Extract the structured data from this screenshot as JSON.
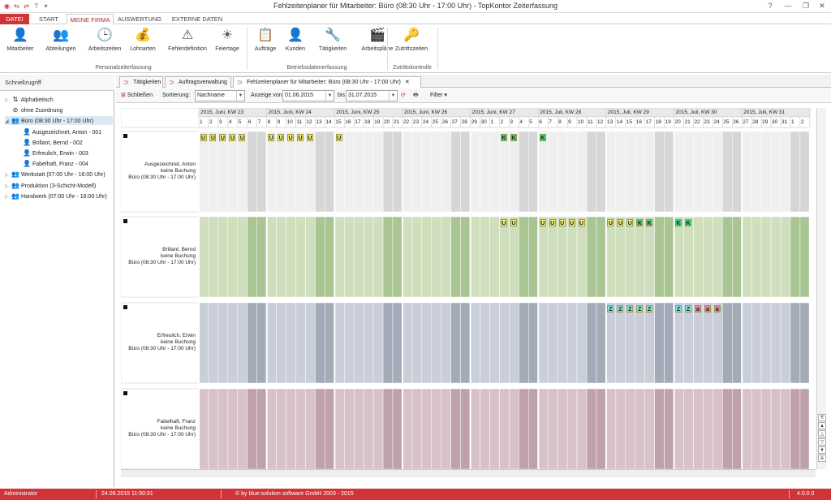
{
  "window": {
    "title": "Fehlzeitenplaner für Mitarbeiter: Büro (08:30 Uhr - 17:00 Uhr) - TopKontor Zeiterfassung"
  },
  "ribbon_tabs": [
    {
      "label": "DATEI",
      "kind": "file"
    },
    {
      "label": "START",
      "kind": "normal"
    },
    {
      "label": "MEINE FIRMA",
      "kind": "active"
    },
    {
      "label": "AUSWERTUNG",
      "kind": "normal"
    },
    {
      "label": "EXTERNE DATEN",
      "kind": "normal"
    }
  ],
  "ribbon_groups": [
    {
      "label": "Personalzeiterfassung",
      "buttons": [
        {
          "label": "Mitarbeiter",
          "icon": "person-icon",
          "glyph": "👤"
        },
        {
          "label": "Abteilungen",
          "icon": "group-icon",
          "glyph": "👥"
        },
        {
          "label": "Arbeitszeiten",
          "icon": "clock-icon",
          "glyph": "🕒"
        },
        {
          "label": "Lohnarten",
          "icon": "coins-icon",
          "glyph": "💰"
        },
        {
          "label": "Fehlerdefinition",
          "icon": "warning-icon",
          "glyph": "⚠"
        },
        {
          "label": "Feiertage",
          "icon": "sun-icon",
          "glyph": "☀"
        }
      ]
    },
    {
      "label": "Betriebsdatenerfassung",
      "buttons": [
        {
          "label": "Aufträge",
          "icon": "orders-icon",
          "glyph": "📋"
        },
        {
          "label": "Kunden",
          "icon": "customer-icon",
          "glyph": "👤"
        },
        {
          "label": "Tätigkeiten",
          "icon": "tools-icon",
          "glyph": "🔧"
        },
        {
          "label": "Arbeitspläne",
          "icon": "plan-icon",
          "glyph": "🎬"
        }
      ]
    },
    {
      "label": "Zutrittskontrolle",
      "buttons": [
        {
          "label": "Zutrittszeiten",
          "icon": "key-icon",
          "glyph": "🔑"
        }
      ]
    }
  ],
  "sidebar": {
    "title": "Schnellzugriff",
    "items": [
      {
        "label": "Alphabetisch",
        "icon": "sort-az-icon",
        "glyph": "⇅",
        "level": 0,
        "expander": "▷",
        "selected": false
      },
      {
        "label": "ohne Zuordnung",
        "icon": "no-entry-icon",
        "glyph": "⊘",
        "level": 0,
        "expander": "",
        "selected": false
      },
      {
        "label": "Büro (08:30 Uhr - 17:00 Uhr)",
        "icon": "group-icon",
        "glyph": "👥",
        "level": 0,
        "expander": "◢",
        "selected": true
      },
      {
        "label": "Ausgezeichnet, Anton - 001",
        "icon": "person-icon",
        "glyph": "👤",
        "level": 1,
        "expander": "",
        "selected": false
      },
      {
        "label": "Brillant, Bernd - 002",
        "icon": "person-icon",
        "glyph": "👤",
        "level": 1,
        "expander": "",
        "selected": false
      },
      {
        "label": "Erfreulich, Erwin - 003",
        "icon": "person-icon",
        "glyph": "👤",
        "level": 1,
        "expander": "",
        "selected": false
      },
      {
        "label": "Fabelhaft, Franz - 004",
        "icon": "person-icon",
        "glyph": "👤",
        "level": 1,
        "expander": "",
        "selected": false
      },
      {
        "label": "Werkstatt (07:00 Uhr - 16:00 Uhr)",
        "icon": "group-icon",
        "glyph": "👥",
        "level": 0,
        "expander": "▷",
        "selected": false
      },
      {
        "label": "Produktion (3-Schicht-Modell)",
        "icon": "group-icon",
        "glyph": "👥",
        "level": 0,
        "expander": "▷",
        "selected": false
      },
      {
        "label": "Handwerk (07:00 Uhr - 16:00 Uhr)",
        "icon": "group-icon",
        "glyph": "👥",
        "level": 0,
        "expander": "▷",
        "selected": false
      }
    ]
  },
  "doc_tabs": [
    {
      "label": "Tätigkeiten",
      "active": false
    },
    {
      "label": "Auftragsverwaltung",
      "active": false
    },
    {
      "label": "Fehlzeitenplaner für Mitarbeiter: Büro (08:30 Uhr - 17:00 Uhr)",
      "active": true,
      "closable": "✕"
    }
  ],
  "toolbar": {
    "close_label": "Schließen",
    "sort_label": "Sortierung:",
    "sort_value": "Nachname",
    "from_label": "Anzeige von",
    "from_value": "01.06.2015",
    "to_label": "bis",
    "to_value": "31.07.2015",
    "filter_label": "Filter"
  },
  "calendar": {
    "weeks": [
      {
        "label": "2015, Juni, KW 23",
        "days": [
          "1",
          "2",
          "3",
          "4",
          "5",
          "6",
          "7"
        ]
      },
      {
        "label": "2015, Juni, KW 24",
        "days": [
          "8",
          "9",
          "10",
          "11",
          "12",
          "13",
          "14"
        ]
      },
      {
        "label": "2015, Juni, KW 25",
        "days": [
          "15",
          "16",
          "17",
          "18",
          "19",
          "20",
          "21"
        ]
      },
      {
        "label": "2015, Juni, KW 26",
        "days": [
          "22",
          "23",
          "24",
          "25",
          "26",
          "27",
          "28"
        ]
      },
      {
        "label": "2015, Juni, KW 27",
        "days": [
          "29",
          "30",
          "1",
          "2",
          "3",
          "4",
          "5"
        ]
      },
      {
        "label": "2015, Juli, KW 28",
        "days": [
          "6",
          "7",
          "8",
          "9",
          "10",
          "11",
          "12"
        ]
      },
      {
        "label": "2015, Juli, KW 29",
        "days": [
          "13",
          "14",
          "15",
          "16",
          "17",
          "18",
          "19"
        ]
      },
      {
        "label": "2015, Juli, KW 30",
        "days": [
          "20",
          "21",
          "22",
          "23",
          "24",
          "25",
          "26"
        ]
      },
      {
        "label": "2015, Juli, KW 31",
        "days": [
          "27",
          "28",
          "29",
          "30",
          "31",
          "1",
          "2"
        ]
      }
    ],
    "badge_colors": {
      "U": "#f3ef7a",
      "K": "#35d98a",
      "Z": "#7ee6e6",
      "a": "#f07ab0"
    },
    "employees": [
      {
        "name": "Ausgezeichnet, Anton",
        "status": "keine Buchung",
        "dept": "Büro (08:30 Uhr - 17:00 Uhr)",
        "weekday_color": "#efefef",
        "weekend_color": "#d6d6d6",
        "absences": [
          {
            "week": 0,
            "day": 0,
            "code": "U"
          },
          {
            "week": 0,
            "day": 1,
            "code": "U"
          },
          {
            "week": 0,
            "day": 2,
            "code": "U"
          },
          {
            "week": 0,
            "day": 3,
            "code": "U"
          },
          {
            "week": 0,
            "day": 4,
            "code": "U"
          },
          {
            "week": 1,
            "day": 0,
            "code": "U"
          },
          {
            "week": 1,
            "day": 1,
            "code": "U"
          },
          {
            "week": 1,
            "day": 2,
            "code": "U"
          },
          {
            "week": 1,
            "day": 3,
            "code": "U"
          },
          {
            "week": 1,
            "day": 4,
            "code": "U"
          },
          {
            "week": 2,
            "day": 0,
            "code": "U"
          },
          {
            "week": 4,
            "day": 3,
            "code": "K"
          },
          {
            "week": 4,
            "day": 4,
            "code": "K"
          },
          {
            "week": 5,
            "day": 0,
            "code": "K"
          }
        ]
      },
      {
        "name": "Brillant, Bernd",
        "status": "keine Buchung",
        "dept": "Büro (08:30 Uhr - 17:00 Uhr)",
        "weekday_color": "#cfdfbd",
        "weekend_color": "#a9c592",
        "absences": [
          {
            "week": 4,
            "day": 3,
            "code": "U"
          },
          {
            "week": 4,
            "day": 4,
            "code": "U"
          },
          {
            "week": 5,
            "day": 0,
            "code": "U"
          },
          {
            "week": 5,
            "day": 1,
            "code": "U"
          },
          {
            "week": 5,
            "day": 2,
            "code": "U"
          },
          {
            "week": 5,
            "day": 3,
            "code": "U"
          },
          {
            "week": 5,
            "day": 4,
            "code": "U"
          },
          {
            "week": 6,
            "day": 0,
            "code": "U"
          },
          {
            "week": 6,
            "day": 1,
            "code": "U"
          },
          {
            "week": 6,
            "day": 2,
            "code": "U"
          },
          {
            "week": 6,
            "day": 3,
            "code": "K"
          },
          {
            "week": 6,
            "day": 4,
            "code": "K"
          },
          {
            "week": 7,
            "day": 0,
            "code": "K"
          },
          {
            "week": 7,
            "day": 1,
            "code": "K"
          }
        ]
      },
      {
        "name": "Erfreulich, Erwin",
        "status": "keine Buchung",
        "dept": "Büro (08:30 Uhr - 17:00 Uhr)",
        "weekday_color": "#c9ced8",
        "weekend_color": "#a4abb8",
        "absences": [
          {
            "week": 6,
            "day": 0,
            "code": "Z"
          },
          {
            "week": 6,
            "day": 1,
            "code": "Z"
          },
          {
            "week": 6,
            "day": 2,
            "code": "Z"
          },
          {
            "week": 6,
            "day": 3,
            "code": "Z"
          },
          {
            "week": 6,
            "day": 4,
            "code": "Z"
          },
          {
            "week": 7,
            "day": 0,
            "code": "Z"
          },
          {
            "week": 7,
            "day": 1,
            "code": "Z"
          },
          {
            "week": 7,
            "day": 2,
            "code": "a"
          },
          {
            "week": 7,
            "day": 3,
            "code": "a"
          },
          {
            "week": 7,
            "day": 4,
            "code": "a"
          }
        ]
      },
      {
        "name": "Fabelhaft, Franz",
        "status": "keine Buchung",
        "dept": "Büro (08:30 Uhr - 17:00 Uhr)",
        "weekday_color": "#d8c2ca",
        "weekend_color": "#bfa1ac",
        "absences": []
      }
    ]
  },
  "statusbar": {
    "user": "Administrator",
    "datetime": "24.09.2015 11:50:31",
    "copyright": "© by blue:solution software GmbH 2003 - 2015",
    "version": "4.0.0.0"
  },
  "colors": {
    "accent": "#d13438"
  }
}
